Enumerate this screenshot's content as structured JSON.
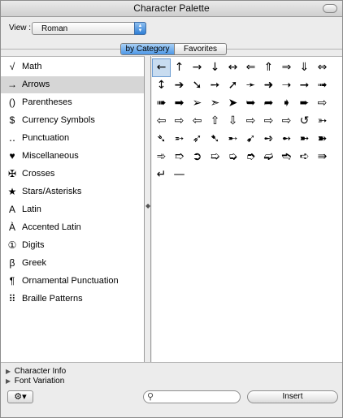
{
  "window": {
    "title": "Character Palette"
  },
  "view": {
    "label": "View :",
    "selected": "Roman"
  },
  "tabs": [
    {
      "label": "by Category",
      "active": true
    },
    {
      "label": "Favorites",
      "active": false
    }
  ],
  "categories": [
    {
      "icon": "√",
      "label": "Math"
    },
    {
      "icon": "→",
      "label": "Arrows",
      "selected": true
    },
    {
      "icon": "()",
      "label": "Parentheses"
    },
    {
      "icon": "$",
      "label": "Currency Symbols"
    },
    {
      "icon": "‥",
      "label": "Punctuation"
    },
    {
      "icon": "♥",
      "label": "Miscellaneous"
    },
    {
      "icon": "✠",
      "label": "Crosses"
    },
    {
      "icon": "★",
      "label": "Stars/Asterisks"
    },
    {
      "icon": "A",
      "label": "Latin"
    },
    {
      "icon": "À",
      "label": "Accented Latin"
    },
    {
      "icon": "①",
      "label": "Digits"
    },
    {
      "icon": "β",
      "label": "Greek"
    },
    {
      "icon": "¶",
      "label": "Ornamental Punctuation"
    },
    {
      "icon": "⠿",
      "label": "Braille Patterns"
    }
  ],
  "glyphs": [
    "←",
    "↑",
    "→",
    "↓",
    "↔",
    "⇐",
    "⇑",
    "⇒",
    "⇓",
    "⇔",
    "↕",
    "➔",
    "➘",
    "➙",
    "➚",
    "➛",
    "➜",
    "➝",
    "➞",
    "➟",
    "➠",
    "➡",
    "➢",
    "➣",
    "➤",
    "➥",
    "➦",
    "➧",
    "➨",
    "⇨",
    "⇦",
    "⇨",
    "⇦",
    "⇧",
    "⇩",
    "⇨",
    "⇨",
    "⇨",
    "↺",
    "➳",
    "➴",
    "➵",
    "➶",
    "➷",
    "➸",
    "➹",
    "➺",
    "➻",
    "➼",
    "➽",
    "➾",
    "➱",
    "➲",
    "➯",
    "➭",
    "➮",
    "➫",
    "➬",
    "➪",
    "⇛",
    "↵",
    "—"
  ],
  "disclosures": [
    {
      "label": "Character Info"
    },
    {
      "label": "Font Variation"
    }
  ],
  "toolbar": {
    "gear_icon": "⚙▾",
    "search_value": "",
    "insert_label": "Insert"
  }
}
